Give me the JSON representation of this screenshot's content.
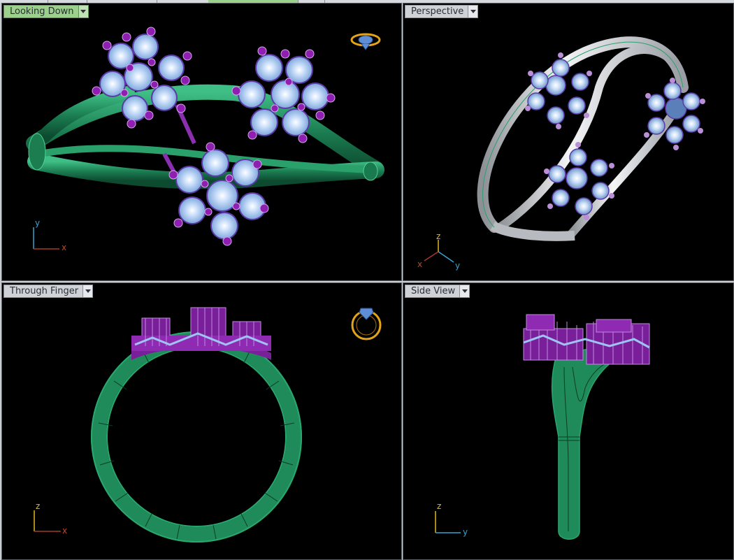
{
  "viewports": {
    "top": {
      "title": "Looking Down"
    },
    "perspective": {
      "title": "Perspective"
    },
    "front": {
      "title": "Through Finger"
    },
    "right": {
      "title": "Side View"
    }
  },
  "axes": {
    "top": {
      "a": "y",
      "b": "x"
    },
    "perspective": {
      "a": "z",
      "b": "x",
      "c": "y"
    },
    "front": {
      "a": "z",
      "b": "x"
    },
    "right": {
      "a": "z",
      "b": "y"
    }
  },
  "colors": {
    "shank_green": "#1f8a5a",
    "prong_purple": "#7a1f9a",
    "gem_blue": "#9dc4f2",
    "metal_white": "#d8dbe0",
    "active_tab": "#9bd18d",
    "icon_gold": "#e3a41a"
  },
  "icons": {
    "top_view_icon": "gem-ring-top-icon",
    "front_view_icon": "ring-front-icon"
  }
}
